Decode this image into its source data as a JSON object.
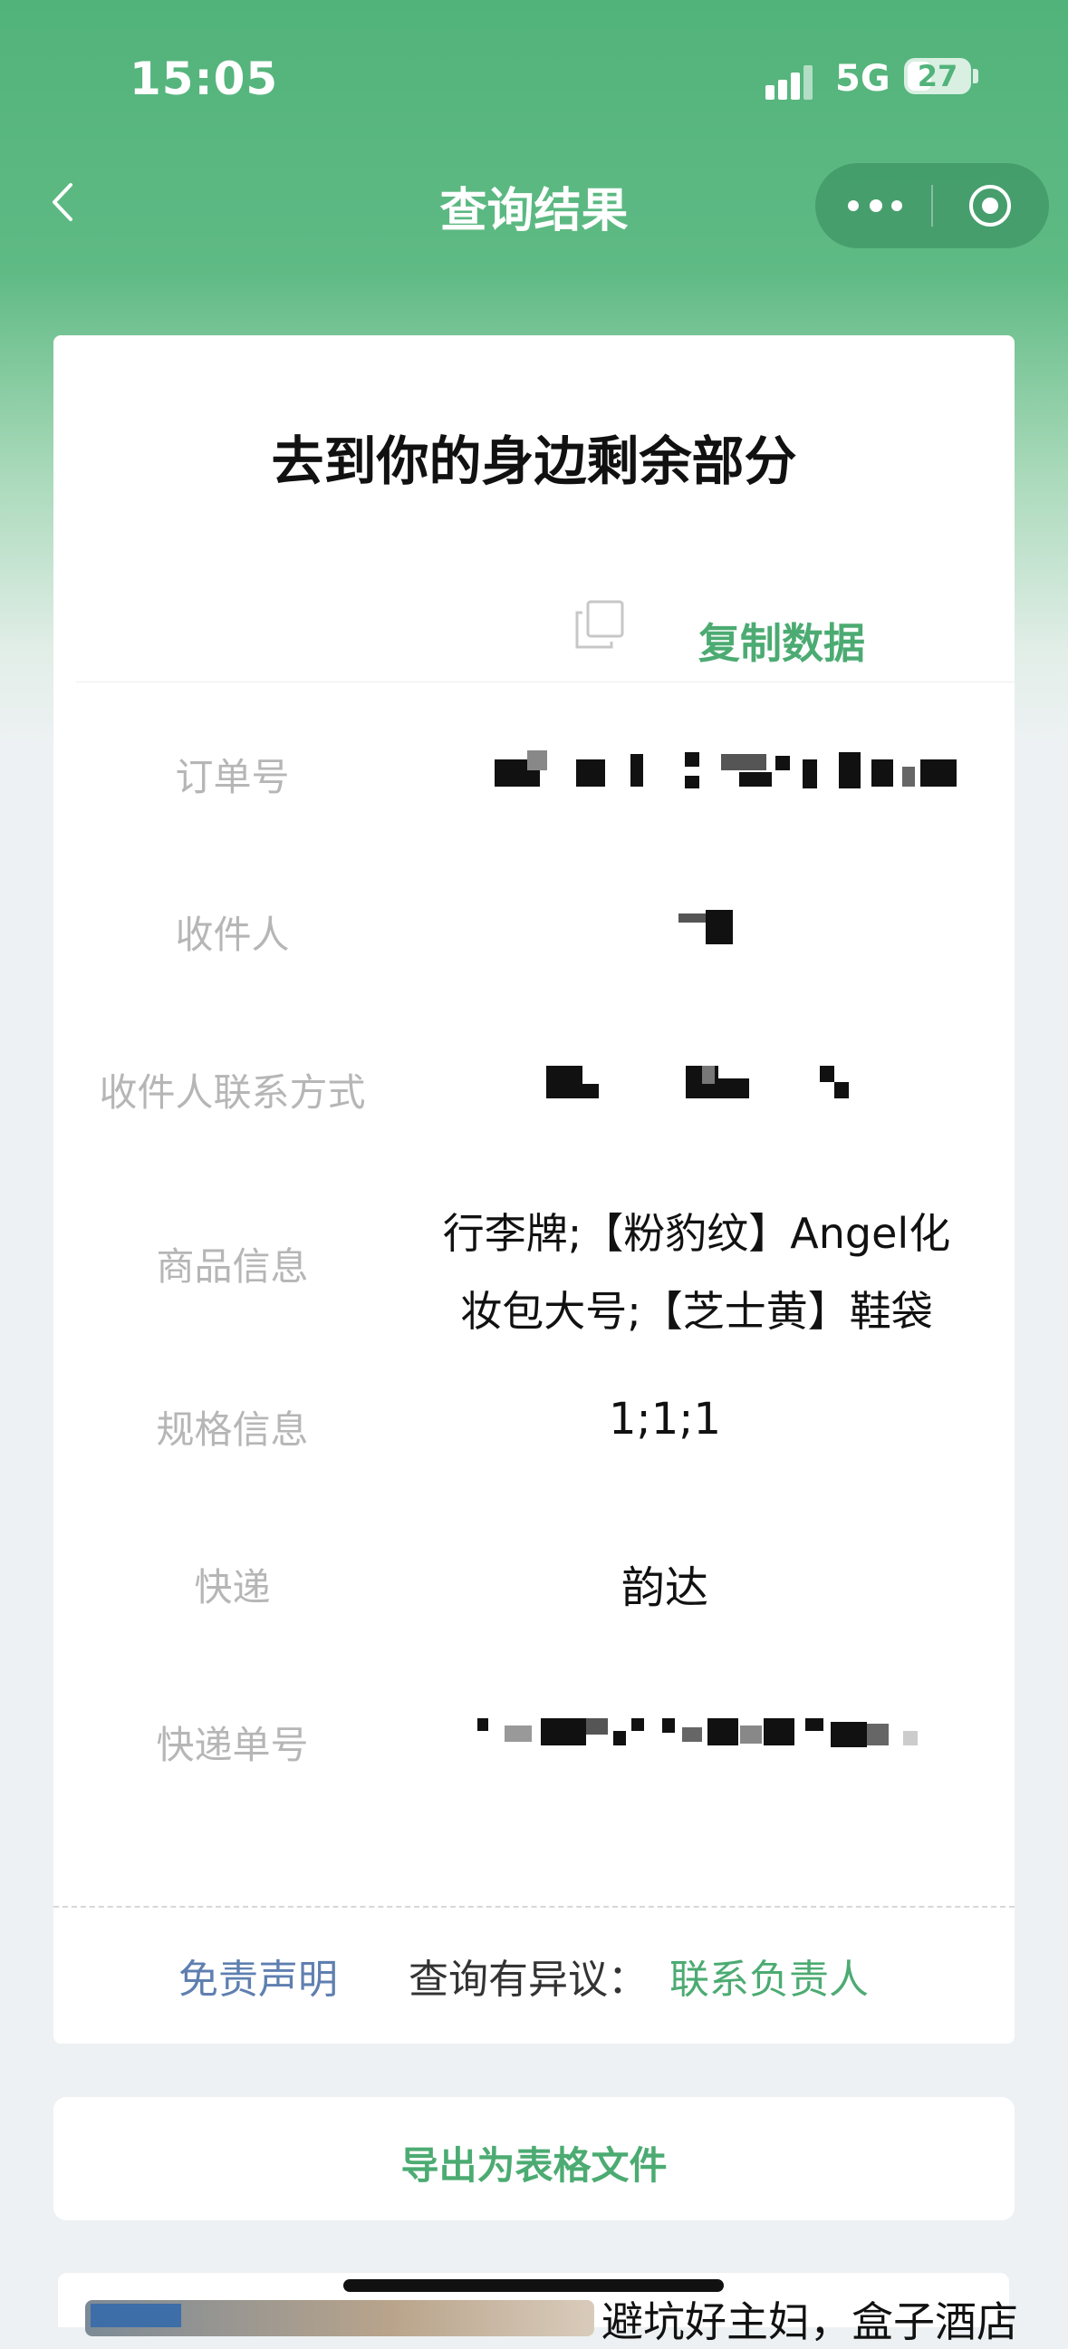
{
  "status_bar": {
    "time": "15:05",
    "network": "5G",
    "battery": "27"
  },
  "nav": {
    "title": "查询结果"
  },
  "card": {
    "title": "去到你的身边剩余部分",
    "copy_label": "复制数据",
    "rows": [
      {
        "label": "订单号",
        "value": ""
      },
      {
        "label": "收件人",
        "value": ""
      },
      {
        "label": "收件人联系方式",
        "value": ""
      },
      {
        "label": "商品信息",
        "value_line1": "行李牌;【粉豹纹】Angel化",
        "value_line2": "妆包大号;【芝士黄】鞋袋"
      },
      {
        "label": "规格信息",
        "value": "1;1;1"
      },
      {
        "label": "快递",
        "value": "韵达"
      },
      {
        "label": "快递单号",
        "value": ""
      }
    ],
    "footer": {
      "disclaimer": "免责声明",
      "query_text": "查询有异议：",
      "contact": "联系负责人"
    }
  },
  "export": {
    "label": "导出为表格文件"
  },
  "ad": {
    "text": "避坑好主妇，盒子酒店"
  },
  "colors": {
    "brand_green": "#4cab72",
    "link_blue": "#5f7fb0"
  }
}
